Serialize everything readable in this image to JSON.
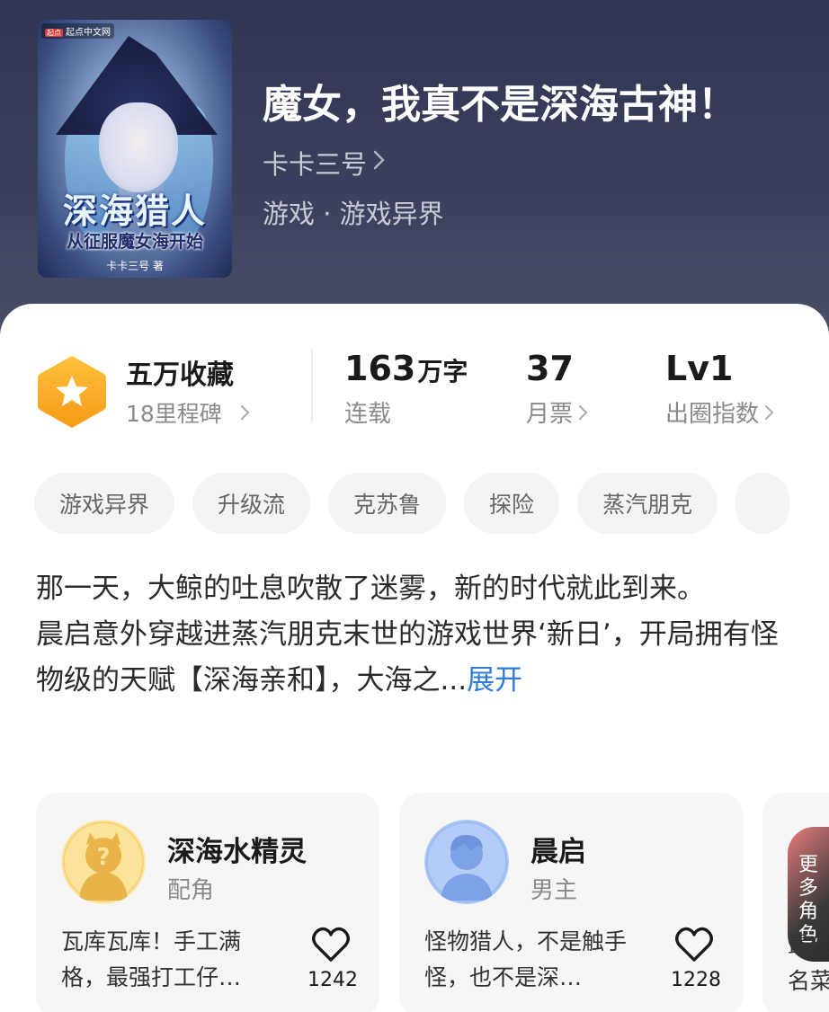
{
  "book": {
    "title": "魔女，我真不是深海古神！",
    "author": "卡卡三号",
    "genre": "游戏 · 游戏异界",
    "cover": {
      "badge": "起点中文网",
      "title": "深海猎人",
      "subtitle": "从征服魔女海开始",
      "author": "卡卡三号 著"
    }
  },
  "stats": {
    "favorites_title": "五万收藏",
    "favorites_sub": "18里程碑",
    "words_value": "163",
    "words_unit": "万字",
    "words_label": "连载",
    "tickets_value": "37",
    "tickets_label": "月票",
    "level_value": "Lv1",
    "level_label": "出圈指数"
  },
  "tags": [
    "游戏异界",
    "升级流",
    "克苏鲁",
    "探险",
    "蒸汽朋克"
  ],
  "description": {
    "line1": "那一天，大鲸的吐息吹散了迷雾，新的时代就此到来。",
    "line2": "晨启意外穿越进蒸汽朋克末世的游戏世界‘新日’，开局拥有怪物级的天赋【深海亲和】，大海之...",
    "expand": "展开"
  },
  "characters": [
    {
      "name": "深海水精灵",
      "role": "配角",
      "quote": "瓦库瓦库！手工满格，最强打工仔…",
      "likes": "1242"
    },
    {
      "name": "晨启",
      "role": "男主",
      "quote": "怪物猎人，不是触手怪，也不是深…",
      "likes": "1228"
    }
  ],
  "more_characters": "更多角色",
  "partial_text": "最优\n名菜",
  "colors": {
    "header_bg": "#343955",
    "link_blue": "#2f7bd8",
    "badge_orange": "#f7a325"
  },
  "icons": [
    "chevron-right-icon",
    "star-badge-icon",
    "heart-icon",
    "question-mark-icon",
    "person-silhouette-icon"
  ]
}
